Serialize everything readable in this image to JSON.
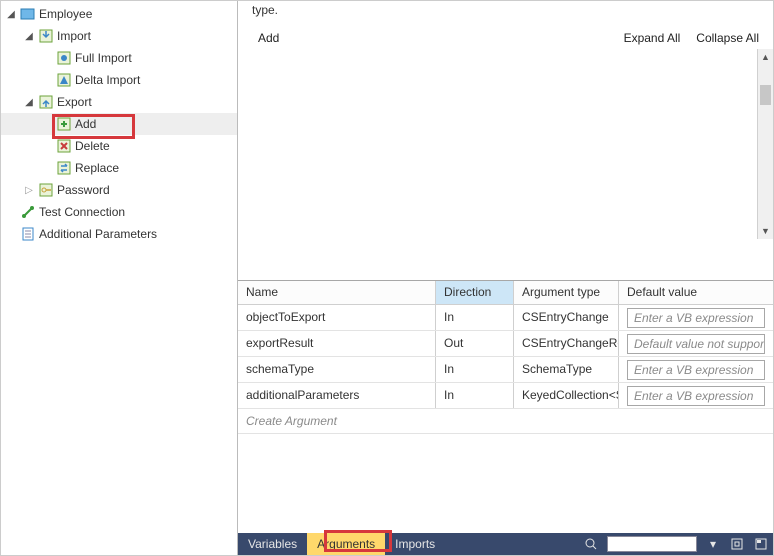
{
  "tree": {
    "root": "Employee",
    "import": "Import",
    "full_import": "Full Import",
    "delta_import": "Delta Import",
    "export": "Export",
    "add": "Add",
    "delete": "Delete",
    "replace": "Replace",
    "password": "Password",
    "test_connection": "Test Connection",
    "additional_parameters": "Additional Parameters"
  },
  "canvas": {
    "remnant_text": "type.",
    "add_label": "Add",
    "expand_all": "Expand All",
    "collapse_all": "Collapse All"
  },
  "args": {
    "headers": {
      "name": "Name",
      "direction": "Direction",
      "type": "Argument type",
      "default": "Default value"
    },
    "rows": [
      {
        "name": "objectToExport",
        "direction": "In",
        "type": "CSEntryChange",
        "default": "Enter a VB expression"
      },
      {
        "name": "exportResult",
        "direction": "Out",
        "type": "CSEntryChangeRes",
        "default": "Default value not suppor"
      },
      {
        "name": "schemaType",
        "direction": "In",
        "type": "SchemaType",
        "default": "Enter a VB expression"
      },
      {
        "name": "additionalParameters",
        "direction": "In",
        "type": "KeyedCollection<S",
        "default": "Enter a VB expression"
      }
    ],
    "create_placeholder": "Create Argument"
  },
  "bottom_tabs": {
    "variables": "Variables",
    "arguments": "Arguments",
    "imports": "Imports"
  }
}
